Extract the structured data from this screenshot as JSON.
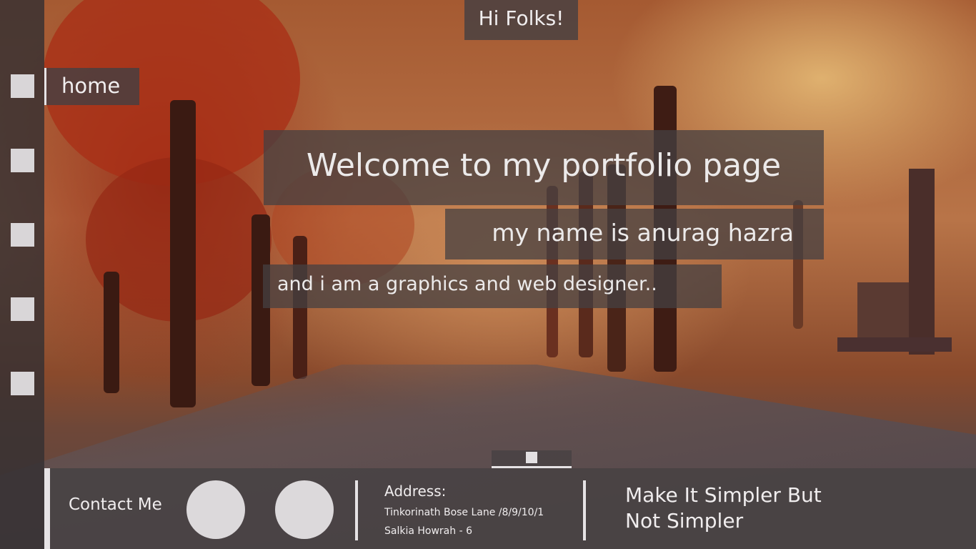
{
  "header": {
    "greeting": "Hi Folks!"
  },
  "sidebar": {
    "active_tab": "home",
    "item_count": 5
  },
  "hero": {
    "title": "Welcome to my portfolio page",
    "name_line": "my name is anurag hazra",
    "role_line": "and i am a graphics and web designer.."
  },
  "footer": {
    "contact_label": "Contact Me",
    "address_title": "Address:",
    "address_line1": "Tinkorinath Bose Lane /8/9/10/1",
    "address_line2": "Salkia Howrah - 6",
    "motto_line1": "Make It Simpler But",
    "motto_line2": "Not Simpler"
  },
  "colors": {
    "panel": "#464042",
    "text": "#f0edee",
    "accent": "#e6e3e5"
  }
}
